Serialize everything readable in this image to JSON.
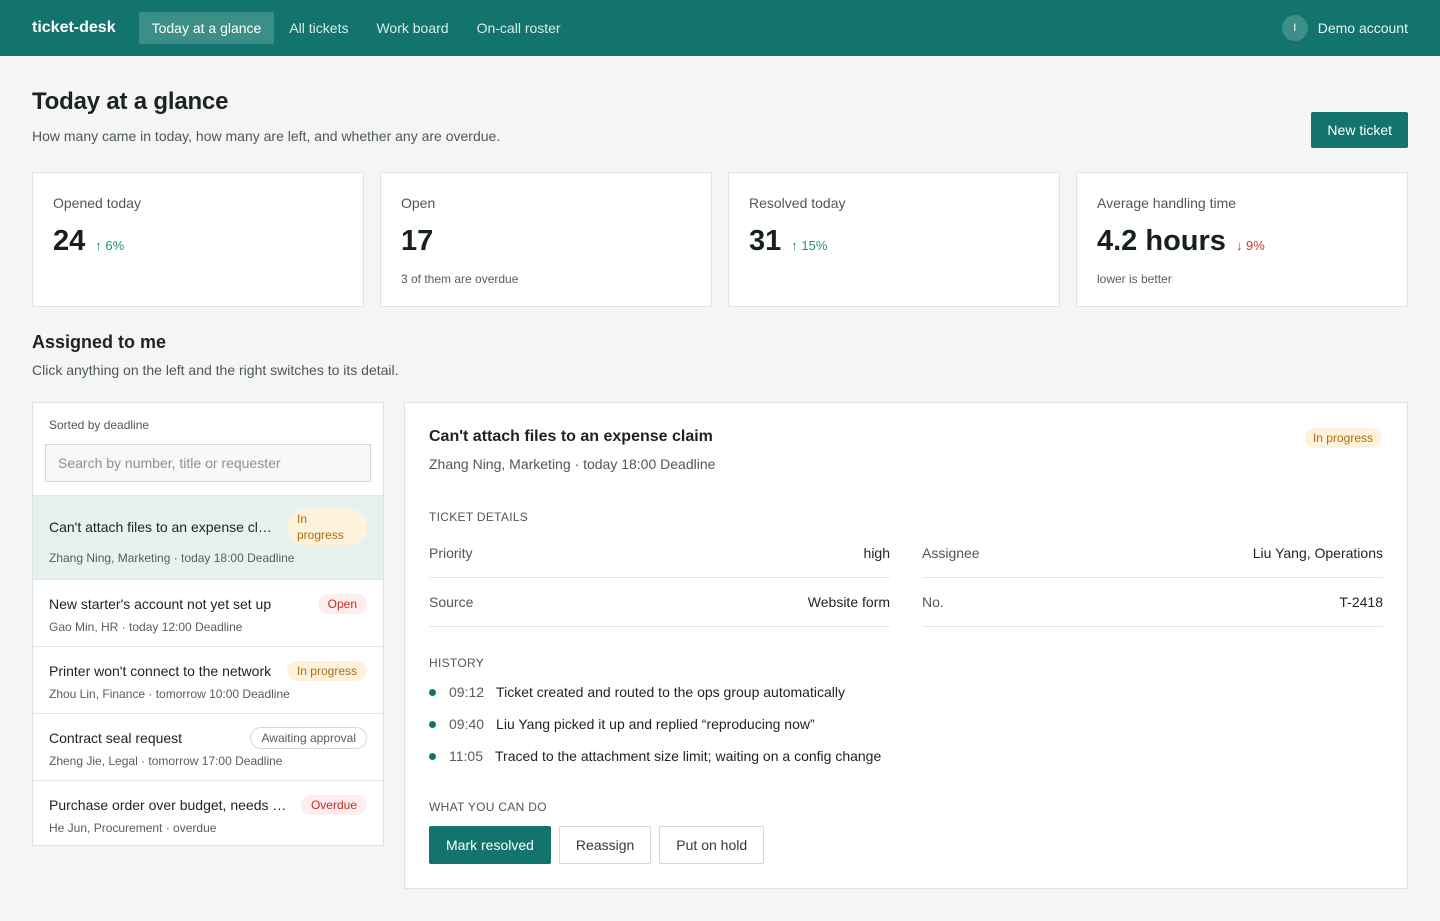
{
  "app": {
    "brand": "ticket-desk",
    "nav": [
      "Today at a glance",
      "All tickets",
      "Work board",
      "On-call roster"
    ],
    "account_initial": "I",
    "account_name": "Demo account"
  },
  "header": {
    "title": "Today at a glance",
    "subtitle": "How many came in today, how many are left, and whether any are overdue.",
    "new_ticket_label": "New ticket"
  },
  "stats": [
    {
      "label": "Opened today",
      "value": "24",
      "trend": "↑ 6%",
      "trend_dir": "up",
      "note": ""
    },
    {
      "label": "Open",
      "value": "17",
      "trend": "",
      "trend_dir": "",
      "note": "3 of them are overdue"
    },
    {
      "label": "Resolved today",
      "value": "31",
      "trend": "↑ 15%",
      "trend_dir": "up",
      "note": ""
    },
    {
      "label": "Average handling time",
      "value": "4.2 hours",
      "trend": "↓ 9%",
      "trend_dir": "down",
      "note": "lower is better"
    }
  ],
  "assigned": {
    "title": "Assigned to me",
    "subtitle": "Click anything on the left and the right switches to its detail.",
    "sort_label": "Sorted by deadline",
    "search_placeholder": "Search by number, title or requester",
    "items": [
      {
        "title": "Can't attach files to an expense claim",
        "meta": "Zhang Ning, Marketing · today 18:00 Deadline",
        "status": "In progress"
      },
      {
        "title": "New starter's account not yet set up",
        "meta": "Gao Min, HR · today 12:00 Deadline",
        "status": "Open"
      },
      {
        "title": "Printer won't connect to the network",
        "meta": "Zhou Lin, Finance · tomorrow 10:00 Deadline",
        "status": "In progress"
      },
      {
        "title": "Contract seal request",
        "meta": "Zheng Jie, Legal · tomorrow 17:00 Deadline",
        "status": "Awaiting approval"
      },
      {
        "title": "Purchase order over budget, needs sign-off",
        "meta": "He Jun, Procurement · overdue",
        "status": "Overdue"
      }
    ]
  },
  "detail": {
    "title": "Can't attach files to an expense claim",
    "meta": "Zhang Ning, Marketing · today 18:00 Deadline",
    "status": "In progress",
    "details_heading": "TICKET DETAILS",
    "fields": {
      "priority_key": "Priority",
      "priority_val": "high",
      "assignee_key": "Assignee",
      "assignee_val": "Liu Yang, Operations",
      "source_key": "Source",
      "source_val": "Website form",
      "no_key": "No.",
      "no_val": "T-2418"
    },
    "history_heading": "HISTORY",
    "history": [
      {
        "time": "09:12",
        "text": "Ticket created and routed to the ops group automatically"
      },
      {
        "time": "09:40",
        "text": "Liu Yang picked it up and replied “reproducing now”"
      },
      {
        "time": "11:05",
        "text": "Traced to the attachment size limit; waiting on a config change"
      }
    ],
    "actions_heading": "WHAT YOU CAN DO",
    "actions": [
      "Mark resolved",
      "Reassign",
      "Put on hold"
    ]
  }
}
